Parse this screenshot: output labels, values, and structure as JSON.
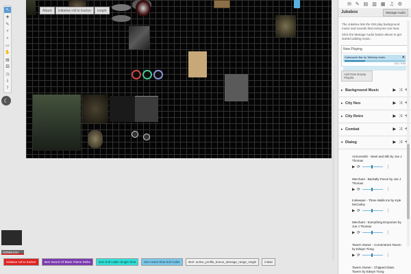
{
  "colors": {
    "map_bg": "#050505",
    "grid": "#333333",
    "accent": "#5b9bd5",
    "now_playing": "#bfe1f0"
  },
  "toolbar": {
    "tools": [
      {
        "name": "select-tool",
        "icon": "pointer-icon",
        "glyph": "↖",
        "active": true
      },
      {
        "name": "layer-tool",
        "icon": "layers-icon",
        "glyph": "◈"
      },
      {
        "name": "draw-tool",
        "icon": "pencil-icon",
        "glyph": "✎"
      },
      {
        "name": "fx-tool",
        "icon": "wand-icon",
        "glyph": "⚡"
      },
      {
        "name": "zoom-tool",
        "icon": "zoom-icon",
        "glyph": "⌕"
      },
      {
        "name": "ruler-tool",
        "icon": "ruler-icon",
        "glyph": "▭"
      },
      {
        "name": "fog-tool",
        "icon": "hand-icon",
        "glyph": "✋"
      },
      {
        "name": "turn-tool",
        "icon": "turn-icon",
        "glyph": "▤"
      },
      {
        "name": "dice-tool",
        "icon": "dice-icon",
        "glyph": "⚄"
      },
      {
        "name": "clock-tool",
        "icon": "clock-icon",
        "glyph": "◷"
      },
      {
        "name": "arrow-tool",
        "icon": "arrow-icon",
        "glyph": "⇩"
      },
      {
        "name": "help-tool",
        "icon": "help-icon",
        "glyph": "?"
      }
    ],
    "page_toggle_icon": "moon-icon"
  },
  "map_tabs": [
    "Attack",
    "initiative roll to tracker",
    "knight"
  ],
  "jukebox": {
    "tab_icons": [
      {
        "name": "chat-tab-icon",
        "glyph": "✉"
      },
      {
        "name": "art-tab-icon",
        "glyph": "✎"
      },
      {
        "name": "journal-tab-icon",
        "glyph": "▤"
      },
      {
        "name": "compendium-tab-icon",
        "glyph": "▥"
      },
      {
        "name": "deck-tab-icon",
        "glyph": "▦"
      },
      {
        "name": "music-tab-icon",
        "glyph": "♫"
      },
      {
        "name": "settings-tab-icon",
        "glyph": "⚙"
      }
    ],
    "title": "Jukebox",
    "manage_label": "Manage Audio",
    "desc1": "The Jukebox lets the GM play background music and sounds that everyone can hear.",
    "desc2": "Click the Manage Audio button above to get started adding music.",
    "now_playing": {
      "label": "Now Playing",
      "track": "Cyberpunk Bar by Tabletop Audio",
      "time": "3:01 / 9:00",
      "progress": 0.34
    },
    "add_playlist_label": "Add New Empty Playlist",
    "playlists": [
      {
        "name": "Background Music",
        "open": false
      },
      {
        "name": "City Neo",
        "open": false
      },
      {
        "name": "City Retro",
        "open": false
      },
      {
        "name": "Combat",
        "open": false
      },
      {
        "name": "Dialog",
        "open": true
      }
    ],
    "tracks": [
      {
        "title": "Armorsmith - Steel and Silk by Joe J Thomas",
        "volume": 0.45
      },
      {
        "title": "Merchant - Backally Fence by Joe J Thomas",
        "volume": 0.45
      },
      {
        "title": "Innkeeper - Three Walls Inn by Kyle McCarley",
        "volume": 0.45
      },
      {
        "title": "Merchant - Everything Emporium by Joe J Thomas",
        "volume": 0.45
      },
      {
        "title": "Tavern Owner - Cornerstreet Tavern by Edwyn Tiong",
        "volume": 0.45
      },
      {
        "title": "Tavern Owner - Chipped Glass Tavern by Edwyn Tiong",
        "volume": 0.45
      }
    ]
  },
  "player": {
    "name": "ODNNUGH"
  },
  "macros": [
    {
      "label": "initiative roll to tracker",
      "bg": "#e02020",
      "fg": "#ffffff"
    },
    {
      "label": "Item Sword Of Black Flame Strike",
      "bg": "#7c3ab0",
      "fg": "#ffffff"
    },
    {
      "label": "item bolt Caller Single Shot",
      "bg": "#30e0d8",
      "fg": "#0a3a3a"
    },
    {
      "label": "item Hand Shot bolt Caller",
      "bg": "#7ac8e8",
      "fg": "#1a3a5a"
    },
    {
      "label": "item: active_profile_bonus_damage_range_single",
      "bg": "#f2f2f2",
      "fg": "#333333"
    },
    {
      "label": "initiati",
      "bg": "#f2f2f2",
      "fg": "#333333"
    }
  ]
}
